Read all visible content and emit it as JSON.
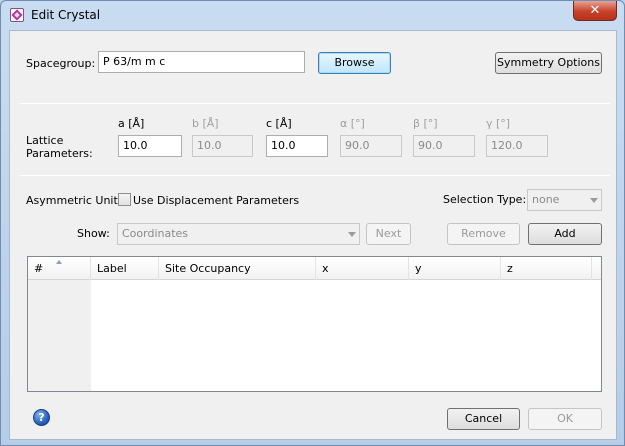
{
  "window": {
    "title": "Edit Crystal",
    "close_glyph": "✕"
  },
  "spacegroup": {
    "label": "Spacegroup:",
    "value": "P 63/m m c",
    "browse": "Browse",
    "symmetry_options": "Symmetry Options"
  },
  "lattice": {
    "label_line1": "Lattice",
    "label_line2": "Parameters:",
    "params": [
      {
        "label": "a [Å]",
        "value": "10.0",
        "enabled": true
      },
      {
        "label": "b [Å]",
        "value": "10.0",
        "enabled": false
      },
      {
        "label": "c [Å]",
        "value": "10.0",
        "enabled": true
      },
      {
        "label": "α [°]",
        "value": "90.0",
        "enabled": false
      },
      {
        "label": "β [°]",
        "value": "90.0",
        "enabled": false
      },
      {
        "label": "γ [°]",
        "value": "120.0",
        "enabled": false
      }
    ]
  },
  "asym": {
    "label": "Asymmetric Unit:",
    "use_displacement": "Use Displacement Parameters",
    "use_displacement_checked": false,
    "selection_type_label": "Selection Type:",
    "selection_type_value": "none",
    "show_label": "Show:",
    "show_value": "Coordinates",
    "next": "Next",
    "remove": "Remove",
    "add": "Add"
  },
  "table": {
    "columns": [
      "#",
      "Label",
      "Site Occupancy",
      "x",
      "y",
      "z"
    ]
  },
  "footer": {
    "help_glyph": "?",
    "cancel": "Cancel",
    "ok": "OK"
  },
  "icons": {
    "app": "crystal-app-icon",
    "help": "help-icon"
  }
}
